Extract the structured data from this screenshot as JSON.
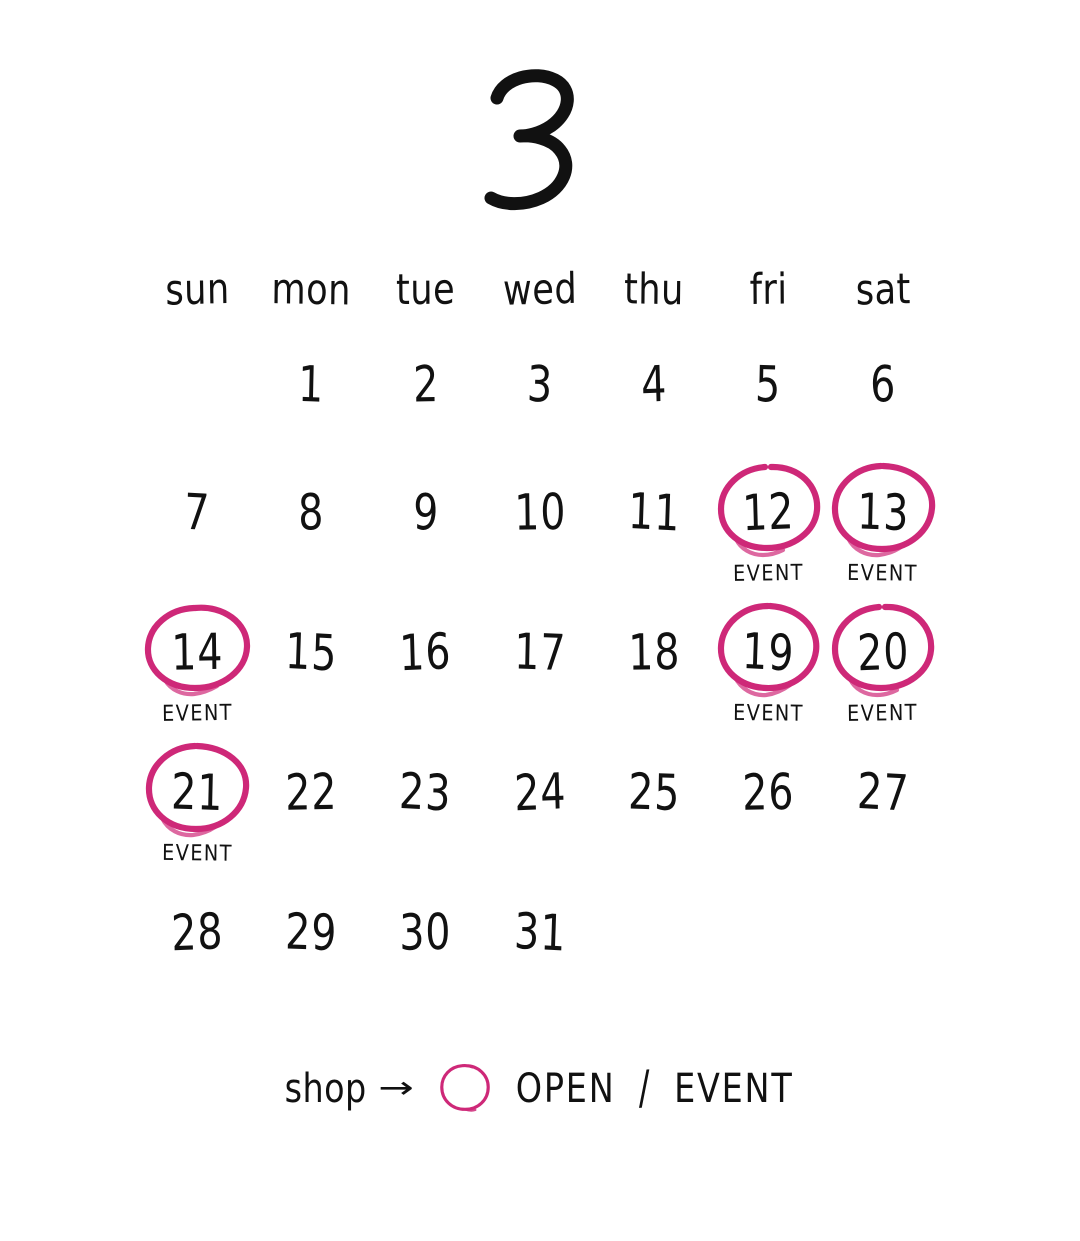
{
  "page": {
    "background_color": "#ffffff",
    "ink_color": "#111111",
    "accent_color": "#CE2878"
  },
  "header": {
    "month_number": "3"
  },
  "weekdays": [
    {
      "label": "sun"
    },
    {
      "label": "mon"
    },
    {
      "label": "tue"
    },
    {
      "label": "wed"
    },
    {
      "label": "thu"
    },
    {
      "label": "fri"
    },
    {
      "label": "sat"
    }
  ],
  "event_label": "EVENT",
  "weeks": [
    [
      {
        "day": "",
        "circled": false,
        "event": false
      },
      {
        "day": "1",
        "circled": false,
        "event": false
      },
      {
        "day": "2",
        "circled": false,
        "event": false
      },
      {
        "day": "3",
        "circled": false,
        "event": false
      },
      {
        "day": "4",
        "circled": false,
        "event": false
      },
      {
        "day": "5",
        "circled": false,
        "event": false
      },
      {
        "day": "6",
        "circled": false,
        "event": false
      }
    ],
    [
      {
        "day": "7",
        "circled": false,
        "event": false
      },
      {
        "day": "8",
        "circled": false,
        "event": false
      },
      {
        "day": "9",
        "circled": false,
        "event": false
      },
      {
        "day": "10",
        "circled": false,
        "event": false
      },
      {
        "day": "11",
        "circled": false,
        "event": false
      },
      {
        "day": "12",
        "circled": true,
        "event": true
      },
      {
        "day": "13",
        "circled": true,
        "event": true
      }
    ],
    [
      {
        "day": "14",
        "circled": true,
        "event": true
      },
      {
        "day": "15",
        "circled": false,
        "event": false
      },
      {
        "day": "16",
        "circled": false,
        "event": false
      },
      {
        "day": "17",
        "circled": false,
        "event": false
      },
      {
        "day": "18",
        "circled": false,
        "event": false
      },
      {
        "day": "19",
        "circled": true,
        "event": true
      },
      {
        "day": "20",
        "circled": true,
        "event": true
      }
    ],
    [
      {
        "day": "21",
        "circled": true,
        "event": true
      },
      {
        "day": "22",
        "circled": false,
        "event": false
      },
      {
        "day": "23",
        "circled": false,
        "event": false
      },
      {
        "day": "24",
        "circled": false,
        "event": false
      },
      {
        "day": "25",
        "circled": false,
        "event": false
      },
      {
        "day": "26",
        "circled": false,
        "event": false
      },
      {
        "day": "27",
        "circled": false,
        "event": false
      }
    ],
    [
      {
        "day": "28",
        "circled": false,
        "event": false
      },
      {
        "day": "29",
        "circled": false,
        "event": false
      },
      {
        "day": "30",
        "circled": false,
        "event": false
      },
      {
        "day": "31",
        "circled": false,
        "event": false
      },
      {
        "day": "",
        "circled": false,
        "event": false
      },
      {
        "day": "",
        "circled": false,
        "event": false
      },
      {
        "day": "",
        "circled": false,
        "event": false
      }
    ]
  ],
  "legend": {
    "shop_text": "shop",
    "arrow": "→",
    "circle_icon": "hand-drawn-circle",
    "open_text": "OPEN",
    "separator": "/",
    "event_text": "EVENT"
  }
}
